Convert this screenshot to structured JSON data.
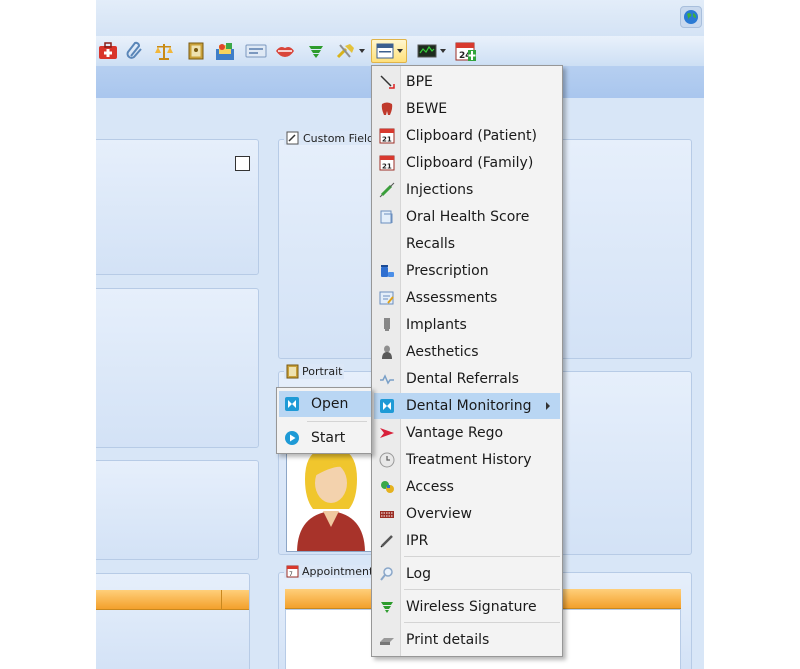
{
  "toolbar": {
    "icons": [
      "medical-kit-icon",
      "paperclip-icon",
      "scales-icon",
      "portrait-icon",
      "images-icon",
      "card-icon",
      "lips-icon",
      "wireless-signature-icon",
      "tools-dropdown-icon",
      "panel-dropdown-icon",
      "monitor-dropdown-icon",
      "calendar-add-icon"
    ],
    "calendar_day": "24"
  },
  "panels": {
    "custom_fields_title": "Custom Fields",
    "portrait_title": "Portrait",
    "appointments_title": "Appointments"
  },
  "context_menu": {
    "items": [
      {
        "label": "BPE",
        "icon": "probe-icon"
      },
      {
        "label": "BEWE",
        "icon": "tooth-icon"
      },
      {
        "label": "Clipboard (Patient)",
        "icon": "calendar-icon"
      },
      {
        "label": "Clipboard (Family)",
        "icon": "calendar-icon"
      },
      {
        "label": "Injections",
        "icon": "syringe-icon"
      },
      {
        "label": "Oral Health Score",
        "icon": "score-icon"
      },
      {
        "label": "Recalls",
        "icon": ""
      },
      {
        "label": "Prescription",
        "icon": "pill-bottle-icon"
      },
      {
        "label": "Assessments",
        "icon": "assessment-icon"
      },
      {
        "label": "Implants",
        "icon": "implant-icon"
      },
      {
        "label": "Aesthetics",
        "icon": "aesthetics-icon"
      },
      {
        "label": "Dental Referrals",
        "icon": "referral-icon"
      },
      {
        "label": "Dental Monitoring",
        "icon": "dental-monitoring-icon"
      },
      {
        "label": "Vantage Rego",
        "icon": "vantage-icon"
      },
      {
        "label": "Treatment History",
        "icon": "clock-icon"
      },
      {
        "label": "Access",
        "icon": "access-icon"
      },
      {
        "label": "Overview",
        "icon": "overview-icon"
      },
      {
        "label": "IPR",
        "icon": "pen-icon"
      },
      {
        "label": "Log",
        "icon": "magnifier-icon"
      },
      {
        "label": "Wireless Signature",
        "icon": "wireless-signature-icon"
      },
      {
        "label": "Print details",
        "icon": "printer-icon"
      }
    ],
    "highlighted": "Dental Monitoring"
  },
  "submenu": {
    "items": [
      {
        "label": "Open",
        "icon": "dental-monitoring-icon"
      },
      {
        "label": "Start",
        "icon": "play-icon"
      }
    ],
    "highlighted": "Open"
  },
  "colors": {
    "highlight": "#b9d6f3",
    "grid_header": "#f3a02c",
    "app_background": "#d8e6f7"
  }
}
